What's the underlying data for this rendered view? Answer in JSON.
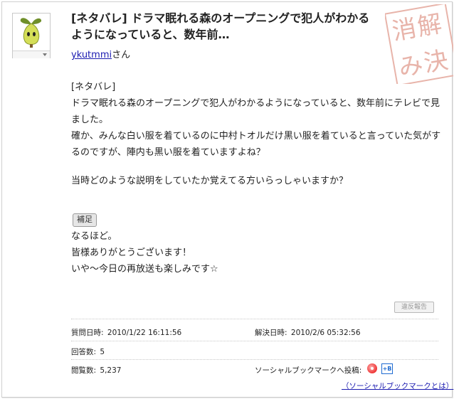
{
  "question": {
    "title": "[ネタバレ] ドラマ眠れる森のオープニングで犯人がわかるようになっていると、数年前…",
    "user": "ykutmmi",
    "user_suffix": "さん",
    "resolved_stamp": "解決済み",
    "body": [
      "[ネタバレ]",
      "ドラマ眠れる森のオープニングで犯人がわかるようになっていると、数年前にテレビで見ました。",
      "確か、みんな白い服を着ているのに中村トオルだけ黒い服を着ていると言っていた気がするのですが、陣内も黒い服を着ていますよね？",
      "当時どのような説明をしていたか覚えてる方いらっしゃいますか？"
    ]
  },
  "supplement": {
    "button_label": "補足",
    "lines": [
      "なるほど。",
      "皆様ありがとうございます！",
      "いや～今日の再放送も楽しみです☆"
    ]
  },
  "report_button": "違反報告",
  "info": {
    "asked_label": "質問日時:",
    "asked_value": "2010/1/22 16:11:56",
    "resolved_label": "解決日時:",
    "resolved_value": "2010/2/6 05:32:56",
    "answers_label": "回答数:",
    "answers_value": "5",
    "views_label": "閲覧数:",
    "views_value": "5,237",
    "social_label": "ソーシャルブックマークへ投稿:",
    "social_link": "（ソーシャルブックマークとは）",
    "hatena_b_label": "+B"
  },
  "colors": {
    "link": "#1a1ab0",
    "stamp": "#e8b4aa",
    "avatar_green": "#c8d94a"
  }
}
